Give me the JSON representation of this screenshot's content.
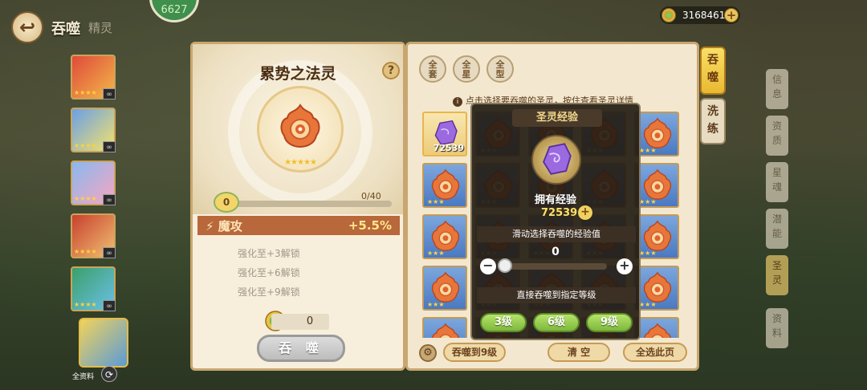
{
  "header": {
    "title": "吞噬",
    "subtitle": "精灵",
    "player_level": "6627",
    "currency_amount": "3168461"
  },
  "pet_list": {
    "badges": [
      "",
      "",
      "",
      "",
      ""
    ],
    "current_label": "全资料"
  },
  "detail": {
    "spirit_name": "累势之法灵",
    "level": "0",
    "exp_progress": "0/40",
    "stat_label": "魔攻",
    "stat_value": "+5.5%",
    "unlocks": [
      "强化至+3解锁",
      "强化至+6解锁",
      "强化至+9解锁"
    ],
    "cost": "0",
    "devour_button": "吞 噬"
  },
  "filters": [
    {
      "label": "全\n套"
    },
    {
      "label": "全\n星"
    },
    {
      "label": "全\n型"
    }
  ],
  "grid": {
    "info_text": "点击选择要吞噬的圣灵，按住查看圣灵详情",
    "selected_count": "72539",
    "bottom_buttons": {
      "devour_to_9": "吞噬到9级",
      "clear": "清 空",
      "select_page": "全选此页"
    }
  },
  "side_tabs": {
    "devour": "吞\n噬",
    "wash": "洗\n练",
    "far_tabs": [
      "信\n息",
      "资\n质",
      "星\n魂",
      "潜\n能",
      "圣\n灵",
      "资\n料"
    ]
  },
  "popup": {
    "title": "圣灵经验",
    "owned_label": "拥有经验",
    "owned_exp": "72539",
    "slider_hint": "滑动选择吞噬的经验值",
    "slider_value": "0",
    "direct_hint": "直接吞噬到指定等级",
    "level_buttons": [
      "3级",
      "6级",
      "9级"
    ]
  },
  "colors": {
    "accent_gold": "#e9b932",
    "stat_bar": "#b8683b",
    "level_button_green": "#7db83c"
  }
}
